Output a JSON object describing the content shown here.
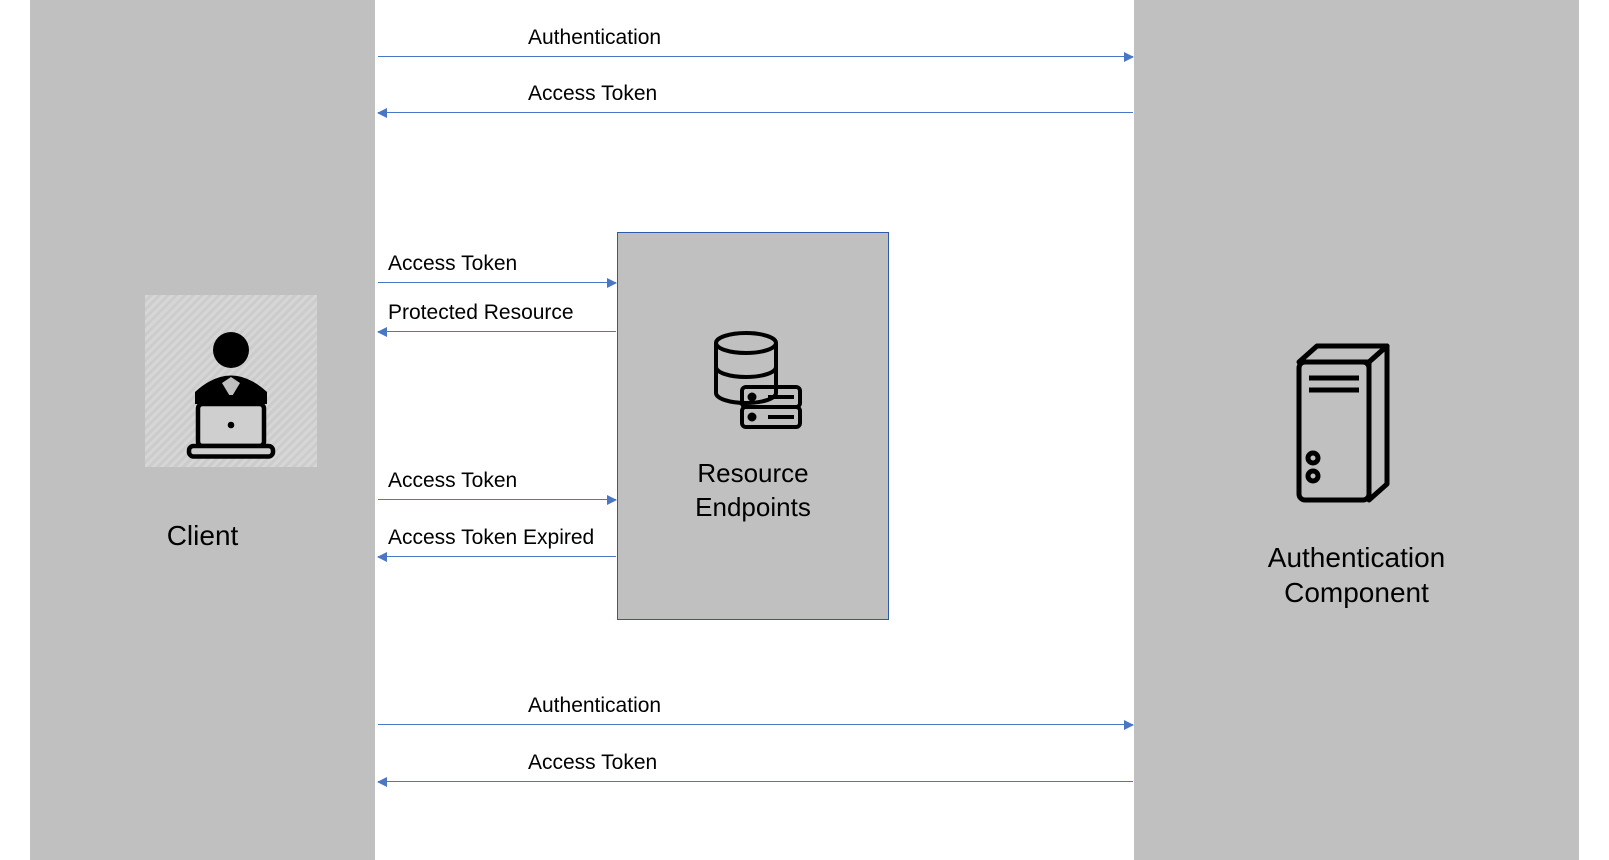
{
  "entities": {
    "client_label": "Client",
    "auth_label_line1": "Authentication",
    "auth_label_line2": "Component",
    "resource_label_line1": "Resource",
    "resource_label_line2": "Endpoints"
  },
  "arrows": {
    "a1": "Authentication",
    "a2": "Access Token",
    "a3": "Access Token",
    "a4": "Protected Resource",
    "a5": "Access Token",
    "a6": "Access Token Expired",
    "a7": "Authentication",
    "a8": "Access Token"
  }
}
